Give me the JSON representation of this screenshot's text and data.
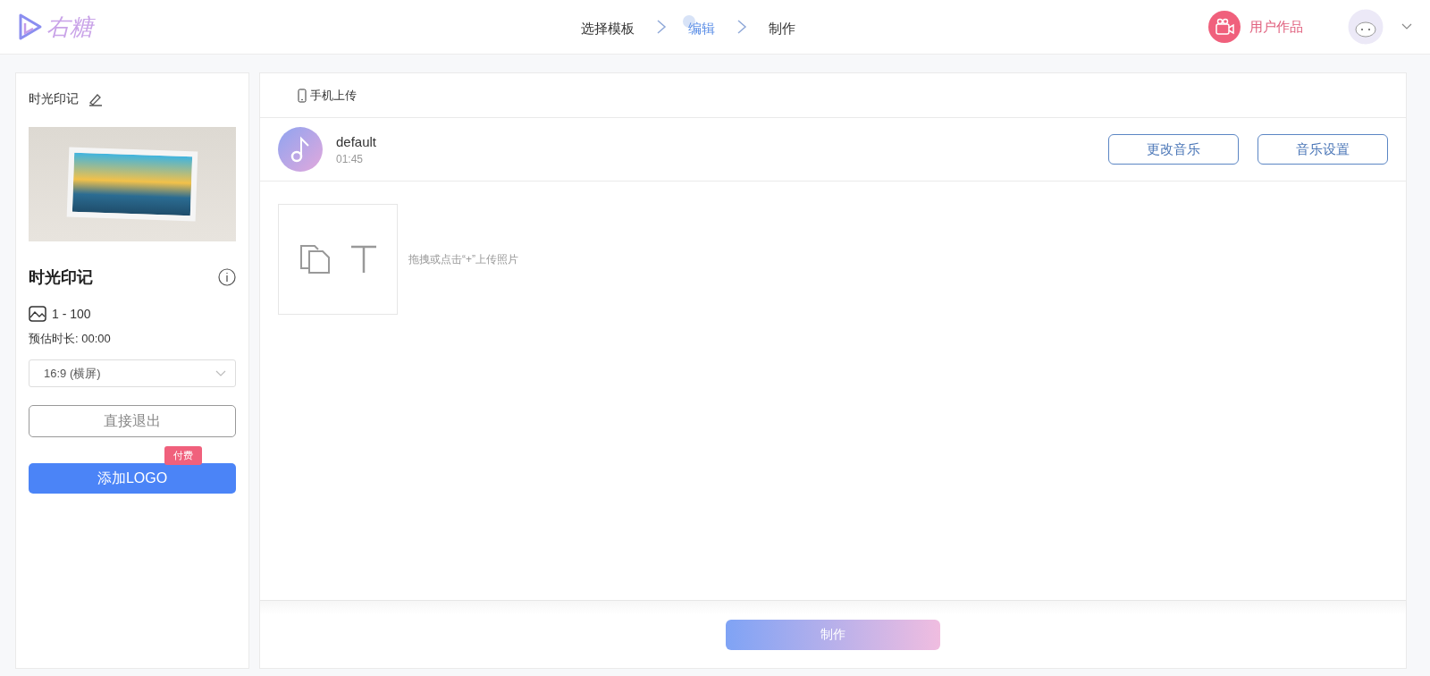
{
  "logo": {
    "text": "右糖"
  },
  "steps": [
    {
      "label": "选择模板",
      "selected": false
    },
    {
      "label": "编辑",
      "selected": true
    },
    {
      "label": "制作",
      "selected": false
    }
  ],
  "user_works": {
    "label": "用户作品"
  },
  "sidebar": {
    "edit_title": "时光印记",
    "template_name": "时光印记",
    "photo_range": "1 - 100",
    "duration": "预估时长: 00:00",
    "ratio_select": {
      "value": "16:9 (横屏)"
    },
    "exit_button": "直接退出",
    "logo_button": "添加LOGO",
    "paid_badge": "付费"
  },
  "toolbar": {
    "phone_upload": "手机上传"
  },
  "music": {
    "name": "default",
    "time": "01:45",
    "buttons": [
      "更改音乐",
      "音乐设置"
    ]
  },
  "upload": {
    "hint": "拖拽或点击“+”上传照片"
  },
  "make_button": "制作"
}
